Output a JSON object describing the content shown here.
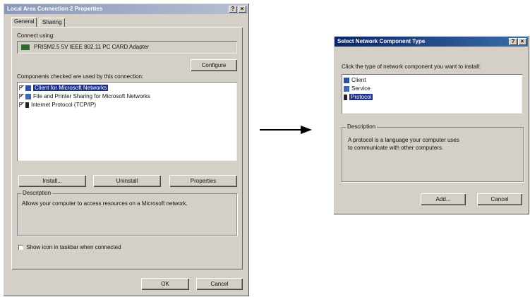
{
  "properties_dialog": {
    "title": "Local Area Connection 2 Properties",
    "help_glyph": "?",
    "close_glyph": "×",
    "tabs": [
      "General",
      "Sharing"
    ],
    "connect_using_label": "Connect using:",
    "adapter_name": "PRISM2.5 5V IEEE 802.11 PC CARD Adapter",
    "configure_button": "Configure",
    "components_label": "Components checked are used by this connection:",
    "components": [
      {
        "label": "Client for Microsoft Networks",
        "checked": "✔",
        "selected": true
      },
      {
        "label": "File and Printer Sharing for Microsoft Networks",
        "checked": "✔",
        "selected": false
      },
      {
        "label": "Internet Protocol (TCP/IP)",
        "checked": "✔",
        "selected": false
      }
    ],
    "install_button": "Install...",
    "uninstall_button": "Uninstall",
    "properties_button": "Properties",
    "description_label": "Description",
    "description_text": "Allows your computer to access resources on a Microsoft network.",
    "show_icon_label": "Show icon in taskbar when connected",
    "ok_button": "OK",
    "cancel_button": "Cancel"
  },
  "select_dialog": {
    "title": "Select Network Component Type",
    "help_glyph": "?",
    "close_glyph": "×",
    "instruction": "Click the type of network component you want to install:",
    "types": [
      {
        "label": "Client",
        "selected": false
      },
      {
        "label": "Service",
        "selected": false
      },
      {
        "label": "Protocol",
        "selected": true
      }
    ],
    "description_label": "Description",
    "description_text": "A protocol is a language your computer uses to communicate with other computers.",
    "add_button": "Add...",
    "cancel_button": "Cancel"
  },
  "colors": {
    "title_active": "#0a246a",
    "title_inactive": "#8a98b8",
    "selection": "#1a2f8c"
  }
}
